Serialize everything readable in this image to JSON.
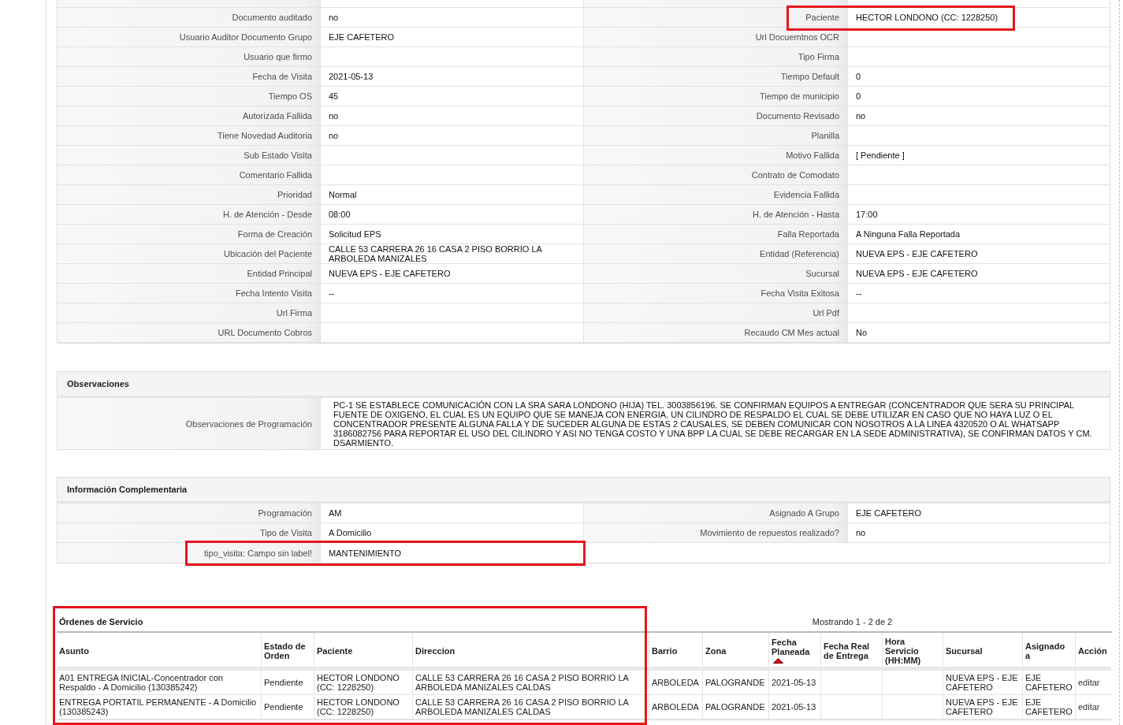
{
  "details": {
    "rows": [
      {
        "cells": [
          {
            "label": "Documento auditado",
            "value": "no",
            "highlighted": false
          },
          {
            "label": "Paciente",
            "value": "HECTOR LONDONO (CC: 1228250)",
            "highlighted": true
          }
        ]
      },
      {
        "cells": [
          {
            "label": "Usuario Auditor Documento Grupo",
            "value": "EJE CAFETERO",
            "highlighted": false
          },
          {
            "label": "Url Docuemtnos OCR",
            "highlighted": false
          }
        ]
      },
      {
        "cells": [
          {
            "label": "Usuario que firmo",
            "highlighted": false
          },
          {
            "label": "Tipo Firma",
            "highlighted": false
          }
        ]
      },
      {
        "cells": [
          {
            "label": "Fecha de Visita",
            "value": "2021-05-13",
            "highlighted": false
          },
          {
            "label": "Tiempo Default",
            "value": "0",
            "highlighted": false
          }
        ]
      },
      {
        "cells": [
          {
            "label": "Tiempo OS",
            "value": "45",
            "highlighted": false
          },
          {
            "label": "Tiempo de municipio",
            "value": "0",
            "highlighted": false
          }
        ]
      },
      {
        "cells": [
          {
            "label": "Autorizada Fallida",
            "value": "no",
            "highlighted": false
          },
          {
            "label": "Documento Revisado",
            "value": "no",
            "highlighted": false
          }
        ]
      },
      {
        "cells": [
          {
            "label": "Tiene Novedad Auditoria",
            "value": "no",
            "highlighted": false
          },
          {
            "label": "Planilla",
            "highlighted": false
          }
        ]
      },
      {
        "cells": [
          {
            "label": "Sub Estado Visita",
            "highlighted": false
          },
          {
            "label": "Motivo Fallida",
            "value": "[ Pendiente ]",
            "highlighted": false
          }
        ]
      },
      {
        "cells": [
          {
            "label": "Comentario Fallida",
            "highlighted": false
          },
          {
            "label": "Contrato de Comodato",
            "highlighted": false
          }
        ]
      },
      {
        "cells": [
          {
            "label": "Prioridad",
            "value": "Normal",
            "highlighted": false
          },
          {
            "label": "Evidencia Fallida",
            "highlighted": false
          }
        ]
      },
      {
        "cells": [
          {
            "label": "H. de Atención - Desde",
            "value": "08:00",
            "highlighted": false
          },
          {
            "label": "H. de Atención - Hasta",
            "value": "17:00",
            "highlighted": false
          }
        ]
      },
      {
        "cells": [
          {
            "label": "Forma de Creación",
            "value": "Solicitud EPS",
            "highlighted": false
          },
          {
            "label": "Falla Reportada",
            "value": "A Ninguna Falla Reportada",
            "highlighted": false
          }
        ]
      },
      {
        "cells": [
          {
            "label": "Ubicación del Paciente",
            "value": "CALLE 53 CARRERA 26 16 CASA 2 PISO BORRIO LA ARBOLEDA MANIZALES",
            "highlighted": false
          },
          {
            "label": "Entidad (Referencia)",
            "value": "NUEVA EPS - EJE CAFETERO",
            "highlighted": false
          }
        ]
      },
      {
        "cells": [
          {
            "label": "Entidad Principal",
            "value": "NUEVA EPS - EJE CAFETERO",
            "highlighted": false
          },
          {
            "label": "Sucursal",
            "value": "NUEVA EPS - EJE CAFETERO",
            "highlighted": false
          }
        ]
      },
      {
        "cells": [
          {
            "label": "Fecha Intento Visita",
            "value": "--",
            "highlighted": false
          },
          {
            "label": "Fecha Visita Exitosa",
            "value": "--",
            "highlighted": false
          }
        ]
      },
      {
        "cells": [
          {
            "label": "Url Firma",
            "highlighted": false
          },
          {
            "label": "Url Pdf",
            "highlighted": false
          }
        ]
      },
      {
        "cells": [
          {
            "label": "URL Documento Cobros",
            "highlighted": false
          },
          {
            "label": "Recaudo CM Mes actual",
            "value": "No",
            "highlighted": false
          }
        ]
      }
    ]
  },
  "observations": {
    "title": "Observaciones",
    "rows": [
      {
        "label": "Observaciones de Programación",
        "value": "PC-1 SE ESTABLECE COMUNICACIÓN CON LA SRA SARA LONDONO (HIJA) TEL. 3003856196. SE CONFIRMAN EQUIPOS A ENTREGAR (CONCENTRADOR QUE SERA SU PRINCIPAL FUENTE DE OXIGENO, EL CUAL ES UN EQUIPO QUE SE MANEJA CON ENERGIA, UN CILINDRO DE RESPALDO EL CUAL SE DEBE UTILIZAR EN CASO QUE NO HAYA LUZ O EL CONCENTRADOR PRESENTE ALGUNA FALLA Y DE SUCEDER ALGUNA DE ESTAS 2 CAUSALES, SE DEBEN COMUNICAR CON NOSOTROS A LA LINEA 4320520 O AL WHATSAPP 3186082756 PARA REPORTAR EL USO DEL CILINDRO Y ASI NO TENGA COSTO Y UNA BPP LA CUAL SE DEBE RECARGAR EN LA SEDE ADMINISTRATIVA), SE CONFIRMAN DATOS Y CM. DSARMIENTO."
      }
    ]
  },
  "complementary": {
    "title": "Información Complementaria",
    "rows": [
      {
        "cells": [
          {
            "label": "Programación",
            "value": "AM",
            "highlighted": false
          },
          {
            "label": "Asignado A Grupo",
            "value": "EJE CAFETERO",
            "highlighted": false
          }
        ]
      },
      {
        "cells": [
          {
            "label": "Tipo de Visita",
            "value": "A Domicilio",
            "highlighted": false
          },
          {
            "label": "Movimiento de repuestos realizado?",
            "value": "no",
            "highlighted": false
          }
        ]
      },
      {
        "cells": [
          {
            "label": "tipo_visita: Campo sin label!",
            "value": "MANTENIMIENTO",
            "highlighted": true
          }
        ]
      }
    ]
  },
  "orders": {
    "title": "Órdenes de Servicio",
    "pager": "Mostrando 1 - 2 de 2",
    "columns": [
      {
        "label": "Asunto",
        "kind": "text",
        "sorted": false,
        "highlighted": true
      },
      {
        "label": "Estado de Orden",
        "kind": "text",
        "sorted": false,
        "highlighted": true
      },
      {
        "label": "Paciente",
        "kind": "text",
        "sorted": false,
        "highlighted": true
      },
      {
        "label": "Direccion",
        "kind": "text",
        "sorted": false,
        "highlighted": true
      },
      {
        "label": "Barrio",
        "kind": "text",
        "sorted": false,
        "highlighted": false
      },
      {
        "label": "Zona",
        "kind": "text",
        "sorted": false,
        "highlighted": false
      },
      {
        "label": "Fecha Planeada",
        "kind": "text",
        "sorted": true,
        "highlighted": false
      },
      {
        "label": "Fecha Real de Entrega",
        "kind": "text",
        "sorted": false,
        "highlighted": false
      },
      {
        "label": "Hora Servicio (HH:MM)",
        "kind": "text",
        "sorted": false,
        "highlighted": false
      },
      {
        "label": "Sucursal",
        "kind": "text",
        "sorted": false,
        "highlighted": false
      },
      {
        "label": "Asignado a",
        "kind": "text",
        "sorted": false,
        "highlighted": false
      },
      {
        "label": "Acción",
        "kind": "link",
        "sorted": false,
        "highlighted": false
      }
    ],
    "rows": [
      {
        "cells": [
          "A01 ENTREGA INICIAL-Concentrador con Respaldo - A Domicilio (130385242)",
          "Pendiente",
          "HECTOR LONDONO (CC: 1228250)",
          "CALLE 53 CARRERA 26 16 CASA 2 PISO BORRIO LA ARBOLEDA MANIZALES CALDAS",
          "ARBOLEDA",
          "PALOGRANDE",
          "2021-05-13",
          null,
          null,
          "NUEVA EPS - EJE CAFETERO",
          "EJE CAFETERO",
          "editar"
        ]
      },
      {
        "cells": [
          "ENTREGA PORTATIL PERMANENTE - A Domicilio (130385243)",
          "Pendiente",
          "HECTOR LONDONO (CC: 1228250)",
          "CALLE 53 CARRERA 26 16 CASA 2 PISO BORRIO LA ARBOLEDA MANIZALES CALDAS",
          "ARBOLEDA",
          "PALOGRANDE",
          "2021-05-13",
          null,
          null,
          "NUEVA EPS - EJE CAFETERO",
          "EJE CAFETERO",
          "editar"
        ]
      }
    ]
  }
}
